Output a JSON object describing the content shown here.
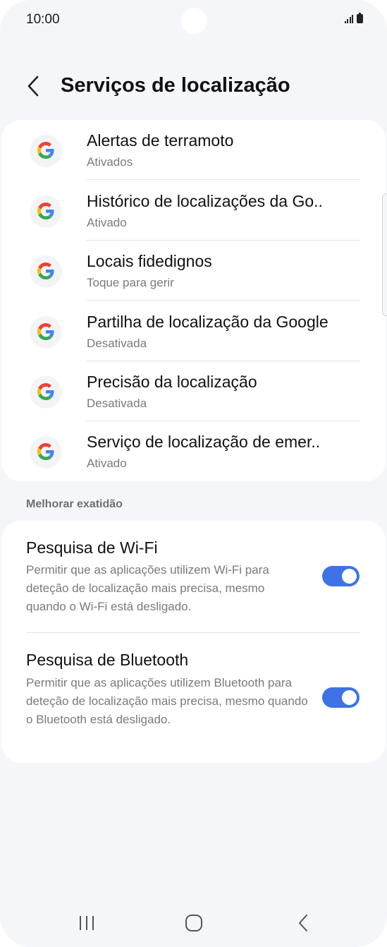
{
  "status_bar": {
    "time": "10:00"
  },
  "header": {
    "title": "Serviços de localização",
    "back_icon": "chevron-left-icon"
  },
  "services": [
    {
      "title": "Alertas de terramoto",
      "subtitle": "Ativados",
      "icon": "google-g-icon"
    },
    {
      "title": "Histórico de localizações da Go..",
      "subtitle": "Ativado",
      "icon": "google-g-icon"
    },
    {
      "title": "Locais fidedignos",
      "subtitle": "Toque para gerir",
      "icon": "google-g-icon"
    },
    {
      "title": "Partilha de localização da Google",
      "subtitle": "Desativada",
      "icon": "google-g-icon"
    },
    {
      "title": "Precisão da localização",
      "subtitle": "Desativada",
      "icon": "google-g-icon"
    },
    {
      "title": "Serviço de localização de emer..",
      "subtitle": "Ativado",
      "icon": "google-g-icon"
    }
  ],
  "accuracy_section": {
    "label": "Melhorar exatidão",
    "items": [
      {
        "title": "Pesquisa de Wi-Fi",
        "description": "Permitir que as aplicações utilizem Wi-Fi para deteção de localização mais precisa, mesmo quando o Wi-Fi está desligado.",
        "enabled": true
      },
      {
        "title": "Pesquisa de Bluetooth",
        "description": "Permitir que as aplicações utilizem Bluetooth para deteção de localização mais precisa, mesmo quando o Bluetooth está desligado.",
        "enabled": true
      }
    ]
  },
  "nav_bar": {
    "recents_icon": "recents-icon",
    "home_icon": "home-icon",
    "back_icon": "back-icon"
  },
  "colors": {
    "accent": "#3e72e6",
    "background": "#f5f6f9",
    "card": "#ffffff",
    "secondary_text": "#7a7a7a"
  }
}
